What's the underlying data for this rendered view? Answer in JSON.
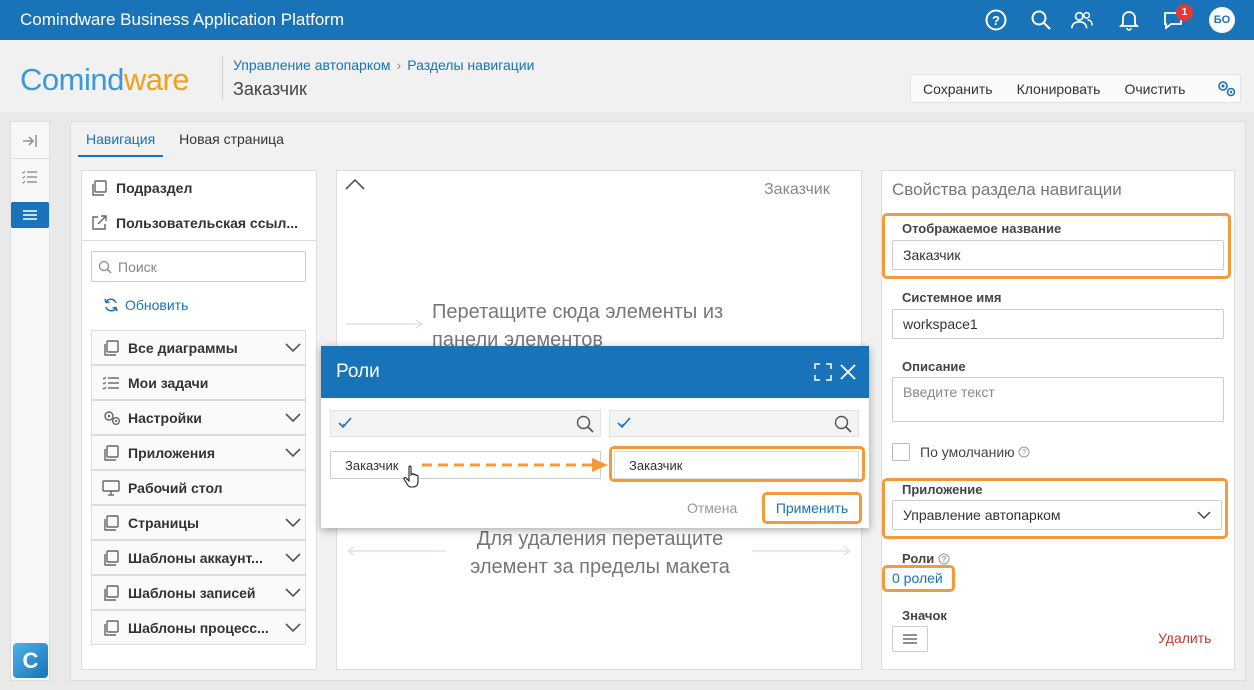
{
  "app_title": "Comindware Business Application Platform",
  "notifications_count": "1",
  "user_initials": "БО",
  "logo": {
    "part1": "Comind",
    "part2": "ware"
  },
  "breadcrumb": {
    "item1": "Управление автопарком",
    "item2": "Разделы навигации"
  },
  "page_title": "Заказчик",
  "toolbar": {
    "save": "Сохранить",
    "clone": "Клонировать",
    "clear": "Очистить"
  },
  "tabs": [
    "Навигация",
    "Новая страница"
  ],
  "elements_panel": {
    "items": [
      "Подраздел",
      "Пользовательская ссыл..."
    ],
    "search_placeholder": "Поиск",
    "refresh": "Обновить",
    "groups": [
      "Все диаграммы",
      "Мои задачи",
      "Настройки",
      "Приложения",
      "Рабочий стол",
      "Страницы",
      "Шаблоны аккаунт...",
      "Шаблоны записей",
      "Шаблоны процесс..."
    ]
  },
  "layout_panel": {
    "title": "Заказчик",
    "drop_hint": "Перетащите сюда элементы из панели элементов",
    "remove_hint": "Для удаления перетащите элемент за пределы макета"
  },
  "properties_panel": {
    "title": "Свойства раздела навигации",
    "display_name_label": "Отображаемое название",
    "display_name_value": "Заказчик",
    "system_name_label": "Системное имя",
    "system_name_value": "workspace1",
    "description_label": "Описание",
    "description_placeholder": "Введите текст",
    "default_label": "По умолчанию",
    "application_label": "Приложение",
    "application_value": "Управление автопарком",
    "roles_label": "Роли",
    "roles_link": "0 ролей",
    "icon_label": "Значок",
    "delete": "Удалить"
  },
  "roles_dialog": {
    "title": "Роли",
    "available_item": "Заказчик",
    "selected_item": "Заказчик",
    "cancel": "Отмена",
    "apply": "Применить"
  },
  "colors": {
    "brand": "#1873b8",
    "highlight": "#f39a3c",
    "badge": "#e53935"
  }
}
